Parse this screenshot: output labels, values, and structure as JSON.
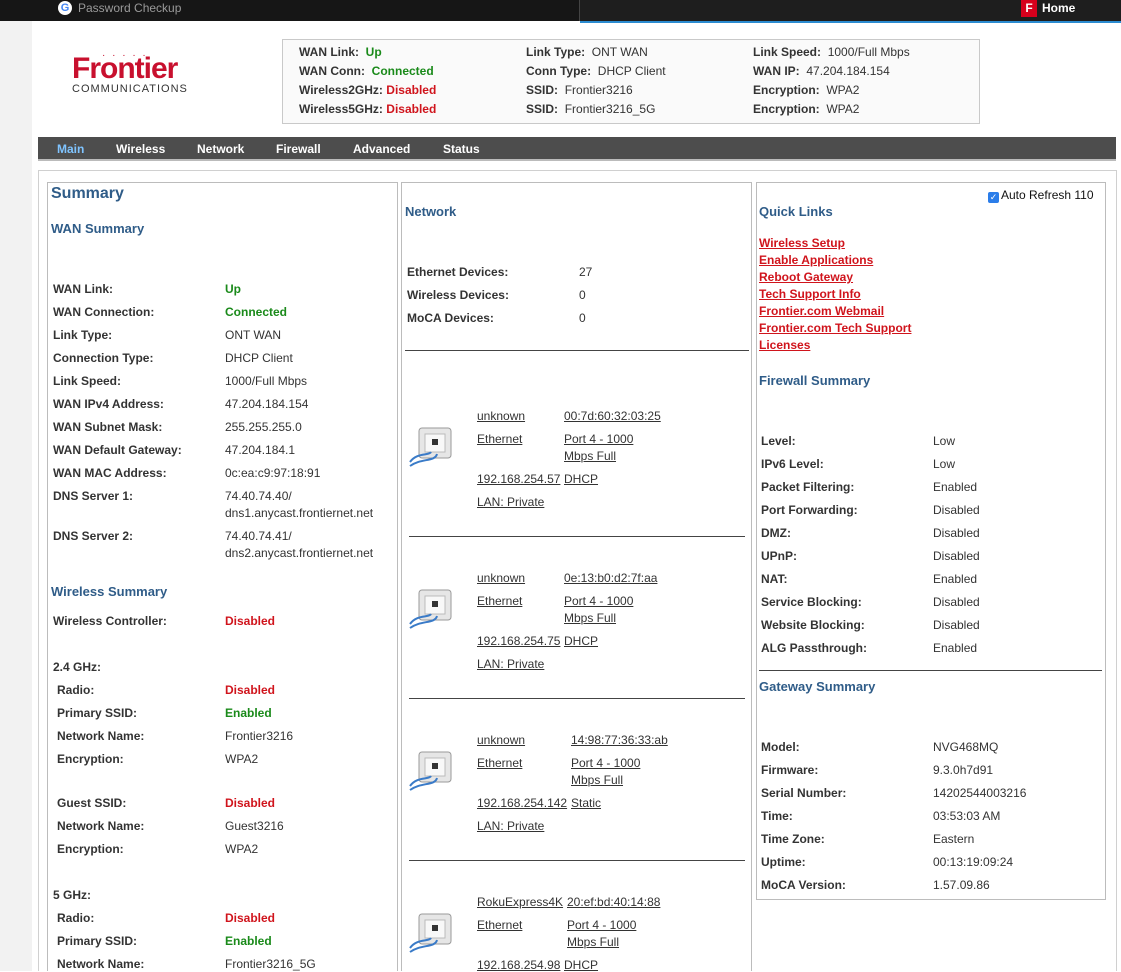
{
  "browser": {
    "extension_label": "Password Checkup",
    "home_label": "Home"
  },
  "logo": {
    "word": "Frontier",
    "sub": "COMMUNICATIONS"
  },
  "status": {
    "col1": [
      {
        "label": "WAN Link:",
        "value": "Up",
        "state": "green"
      },
      {
        "label": "WAN Conn:",
        "value": "Connected",
        "state": "green"
      },
      {
        "label": "Wireless2GHz:",
        "value": "Disabled",
        "state": "red"
      },
      {
        "label": "Wireless5GHz:",
        "value": "Disabled",
        "state": "red"
      }
    ],
    "col2": [
      {
        "label": "Link Type:",
        "value": "ONT WAN"
      },
      {
        "label": "Conn Type:",
        "value": "DHCP Client"
      },
      {
        "label": "SSID:",
        "value": "Frontier3216"
      },
      {
        "label": "SSID:",
        "value": "Frontier3216_5G"
      }
    ],
    "col3": [
      {
        "label": "Link Speed:",
        "value": "1000/Full Mbps"
      },
      {
        "label": "WAN IP:",
        "value": "47.204.184.154"
      },
      {
        "label": "Encryption:",
        "value": "WPA2"
      },
      {
        "label": "Encryption:",
        "value": "WPA2"
      }
    ]
  },
  "nav": [
    "Main",
    "Wireless",
    "Network",
    "Firewall",
    "Advanced",
    "Status"
  ],
  "summary": {
    "title": "Summary",
    "wan_title": "WAN Summary",
    "wan": [
      {
        "k": "WAN Link:",
        "v": "Up",
        "state": "green"
      },
      {
        "k": "WAN Connection:",
        "v": "Connected",
        "state": "green"
      },
      {
        "k": "Link Type:",
        "v": "ONT WAN"
      },
      {
        "k": "Connection Type:",
        "v": "DHCP Client"
      },
      {
        "k": "Link Speed:",
        "v": "1000/Full Mbps"
      },
      {
        "k": "WAN IPv4 Address:",
        "v": "47.204.184.154"
      },
      {
        "k": "WAN Subnet Mask:",
        "v": "255.255.255.0"
      },
      {
        "k": "WAN Default Gateway:",
        "v": "47.204.184.1"
      },
      {
        "k": "WAN MAC Address:",
        "v": "0c:ea:c9:97:18:91"
      }
    ],
    "dns1_label": "DNS Server 1:",
    "dns1_a": "74.40.74.40/",
    "dns1_b": "dns1.anycast.frontiernet.net",
    "dns2_label": "DNS Server 2:",
    "dns2_a": "74.40.74.41/",
    "dns2_b": "dns2.anycast.frontiernet.net",
    "wireless_title": "Wireless Summary",
    "controller_label": "Wireless Controller:",
    "controller_value": "Disabled",
    "band24_label": "2.4 GHz:",
    "band24": [
      {
        "k": "Radio:",
        "v": "Disabled",
        "state": "red"
      },
      {
        "k": "Primary SSID:",
        "v": "Enabled",
        "state": "green"
      },
      {
        "k": "Network Name:",
        "v": "Frontier3216"
      },
      {
        "k": "Encryption:",
        "v": "WPA2"
      }
    ],
    "guest": [
      {
        "k": "Guest SSID:",
        "v": "Disabled",
        "state": "red"
      },
      {
        "k": "Network Name:",
        "v": "Guest3216"
      },
      {
        "k": "Encryption:",
        "v": "WPA2"
      }
    ],
    "band5_label": "5 GHz:",
    "band5": [
      {
        "k": "Radio:",
        "v": "Disabled",
        "state": "red"
      },
      {
        "k": "Primary SSID:",
        "v": "Enabled",
        "state": "green"
      },
      {
        "k": "Network Name:",
        "v": "Frontier3216_5G"
      }
    ]
  },
  "network": {
    "title": "Network",
    "counts": [
      {
        "k": "Ethernet Devices:",
        "v": "27"
      },
      {
        "k": "Wireless Devices:",
        "v": "0"
      },
      {
        "k": "MoCA Devices:",
        "v": "0"
      }
    ],
    "devices": [
      {
        "name": "unknown",
        "mac": "00:7d:60:32:03:25",
        "type": "Ethernet",
        "port1": "Port 4 - 1000",
        "port2": "Mbps Full",
        "ip": "192.168.254.57",
        "mode": "DHCP",
        "lan": "LAN: Private"
      },
      {
        "name": "unknown",
        "mac": "0e:13:b0:d2:7f:aa",
        "type": "Ethernet",
        "port1": "Port 4 - 1000",
        "port2": "Mbps Full",
        "ip": "192.168.254.75",
        "mode": "DHCP",
        "lan": "LAN: Private"
      },
      {
        "name": "unknown",
        "mac": "14:98:77:36:33:ab",
        "type": "Ethernet",
        "port1": "Port 4 - 1000",
        "port2": "Mbps Full",
        "ip": "192.168.254.142",
        "mode": "Static",
        "lan": "LAN: Private"
      },
      {
        "name": "RokuExpress4K",
        "mac": "20:ef:bd:40:14:88",
        "type": "Ethernet",
        "port1": "Port 4 - 1000",
        "port2": "Mbps Full",
        "ip": "192.168.254.98",
        "mode": "DHCP",
        "lan": ""
      }
    ]
  },
  "quick": {
    "auto_refresh": "Auto Refresh 110",
    "title": "Quick Links",
    "links": [
      "Wireless Setup",
      "Enable Applications",
      "Reboot Gateway",
      "Tech Support Info",
      "Frontier.com Webmail",
      "Frontier.com Tech Support",
      "Licenses"
    ],
    "firewall_title": "Firewall Summary",
    "firewall": [
      {
        "k": "Level:",
        "v": "Low"
      },
      {
        "k": "IPv6 Level:",
        "v": "Low"
      },
      {
        "k": "Packet Filtering:",
        "v": "Enabled"
      },
      {
        "k": "Port Forwarding:",
        "v": "Disabled"
      },
      {
        "k": "DMZ:",
        "v": "Disabled"
      },
      {
        "k": "UPnP:",
        "v": "Disabled"
      },
      {
        "k": "NAT:",
        "v": "Enabled"
      },
      {
        "k": "Service Blocking:",
        "v": "Disabled"
      },
      {
        "k": "Website Blocking:",
        "v": "Disabled"
      },
      {
        "k": "ALG Passthrough:",
        "v": "Enabled"
      }
    ],
    "gateway_title": "Gateway Summary",
    "gateway": [
      {
        "k": "Model:",
        "v": "NVG468MQ"
      },
      {
        "k": "Firmware:",
        "v": "9.3.0h7d91"
      },
      {
        "k": "Serial Number:",
        "v": "14202544003216"
      },
      {
        "k": "Time:",
        "v": "03:53:03 AM"
      },
      {
        "k": "Time Zone:",
        "v": "Eastern"
      },
      {
        "k": "Uptime:",
        "v": "00:13:19:09:24"
      },
      {
        "k": "MoCA Version:",
        "v": "1.57.09.86"
      }
    ]
  }
}
